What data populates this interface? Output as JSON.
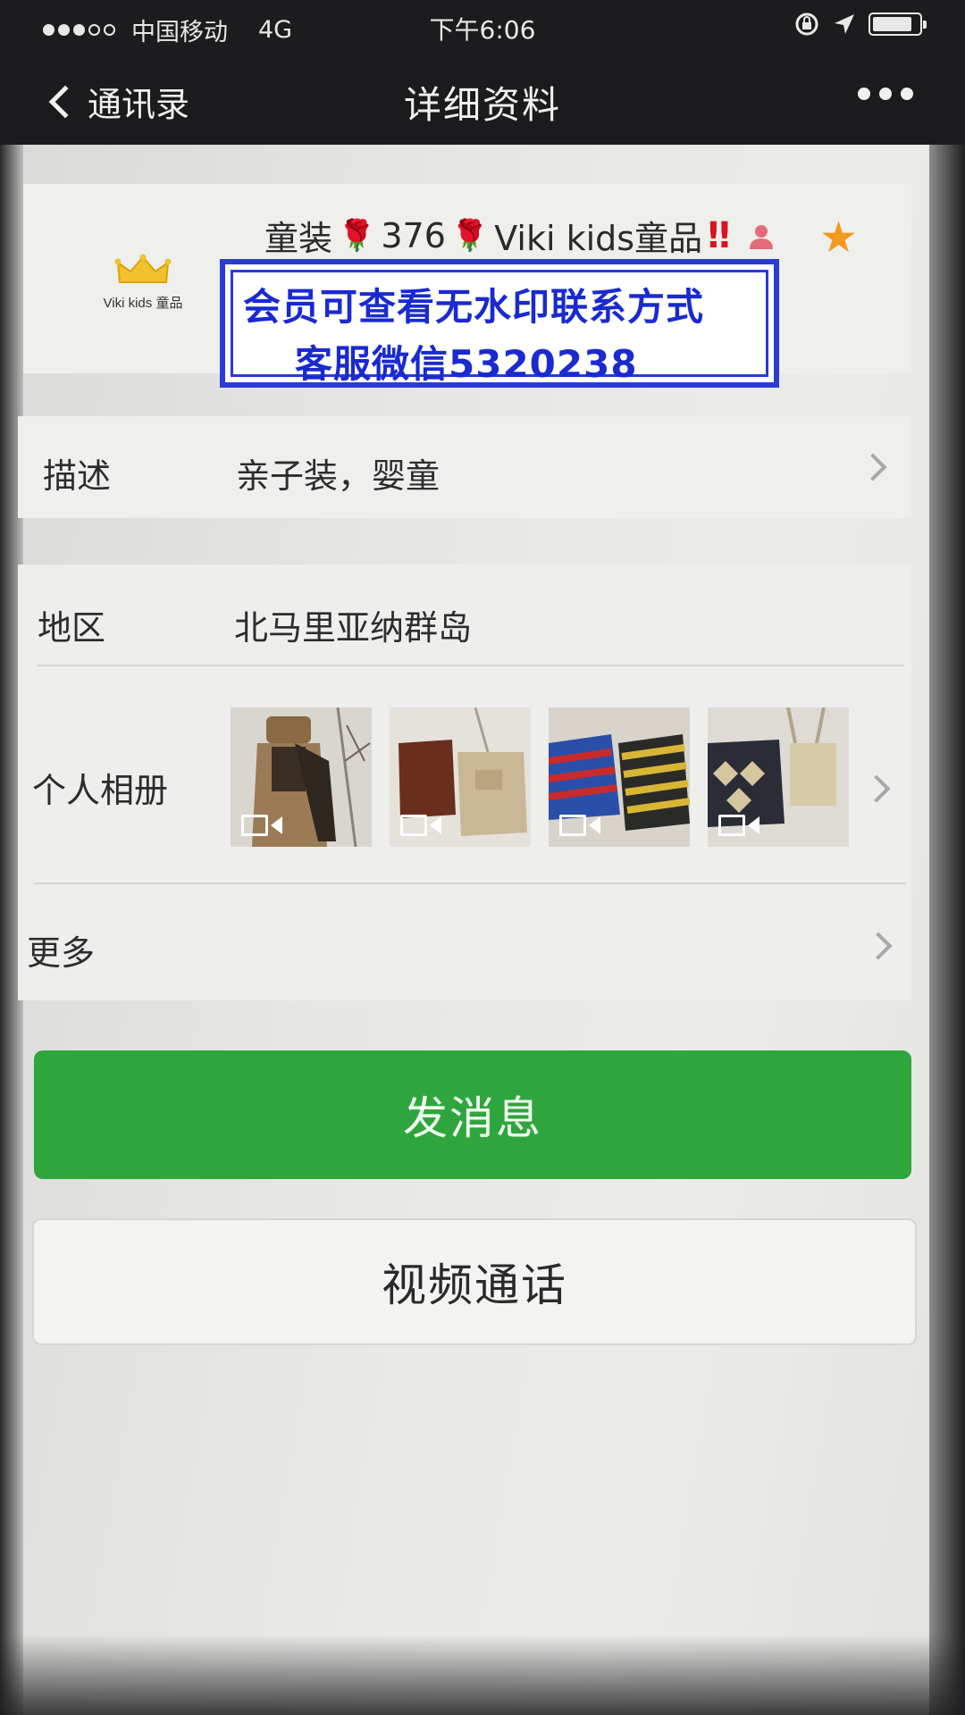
{
  "status_bar": {
    "carrier": "中国移动",
    "network": "4G",
    "time": "下午6:06",
    "battery_level": 0.85
  },
  "nav": {
    "back_label": "通讯录",
    "title": "详细资料"
  },
  "profile": {
    "name_prefix": "童装",
    "name_number": "376",
    "name_suffix": "Viki kids童品",
    "avatar_text": "Viki kids 童品",
    "watermark_line1": "会员可查看无水印联系方式",
    "watermark_line2": "客服微信5320238"
  },
  "rows": {
    "description_label": "描述",
    "description_value": "亲子装，婴童",
    "region_label": "地区",
    "region_value": "北马里亚纳群岛",
    "album_label": "个人相册",
    "more_label": "更多"
  },
  "buttons": {
    "send_message": "发消息",
    "video_call": "视频通话"
  },
  "colors": {
    "accent_green": "#2fa63d",
    "watermark_blue": "#1a2ad0",
    "star_orange": "#f39a1d"
  }
}
